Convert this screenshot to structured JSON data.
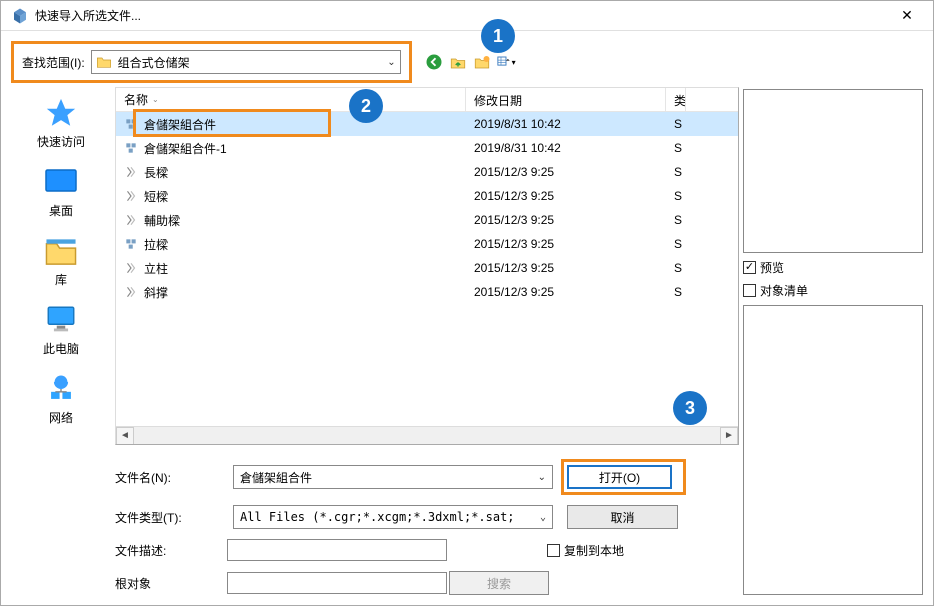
{
  "window": {
    "title": "快速导入所选文件..."
  },
  "lookIn": {
    "label": "查找范围(I):",
    "current": "组合式仓储架"
  },
  "columns": {
    "name": "名称",
    "date": "修改日期",
    "type": "类"
  },
  "files": [
    {
      "name": "倉儲架組合件",
      "date": "2019/8/31 10:42",
      "type": "S",
      "icon": "assembly",
      "selected": true
    },
    {
      "name": "倉儲架組合件-1",
      "date": "2019/8/31 10:42",
      "type": "S",
      "icon": "assembly",
      "selected": false
    },
    {
      "name": "長樑",
      "date": "2015/12/3 9:25",
      "type": "S",
      "icon": "part",
      "selected": false
    },
    {
      "name": "短樑",
      "date": "2015/12/3 9:25",
      "type": "S",
      "icon": "part",
      "selected": false
    },
    {
      "name": "輔助樑",
      "date": "2015/12/3 9:25",
      "type": "S",
      "icon": "part",
      "selected": false
    },
    {
      "name": "拉樑",
      "date": "2015/12/3 9:25",
      "type": "S",
      "icon": "assembly",
      "selected": false
    },
    {
      "name": "立柱",
      "date": "2015/12/3 9:25",
      "type": "S",
      "icon": "part",
      "selected": false
    },
    {
      "name": "斜撑",
      "date": "2015/12/3 9:25",
      "type": "S",
      "icon": "part",
      "selected": false
    }
  ],
  "sidebar": [
    {
      "key": "quick",
      "label": "快速访问"
    },
    {
      "key": "desktop",
      "label": "桌面"
    },
    {
      "key": "library",
      "label": "库"
    },
    {
      "key": "thispc",
      "label": "此电脑"
    },
    {
      "key": "network",
      "label": "网络"
    }
  ],
  "form": {
    "filenameLabel": "文件名(N):",
    "filenameValue": "倉儲架組合件",
    "filetypeLabel": "文件类型(T):",
    "filetypeValue": "All Files (*.cgr;*.xcgm;*.3dxml;*.sat;",
    "openLabel": "打开(O)",
    "cancelLabel": "取消",
    "descLabel": "文件描述:",
    "rootLabel": "根对象",
    "searchLabel": "搜索",
    "copyLocalLabel": "复制到本地"
  },
  "rightPane": {
    "previewLabel": "预览",
    "objectListLabel": "对象清单",
    "previewChecked": true,
    "objectListChecked": false
  },
  "callouts": {
    "one": "1",
    "two": "2",
    "three": "3"
  }
}
